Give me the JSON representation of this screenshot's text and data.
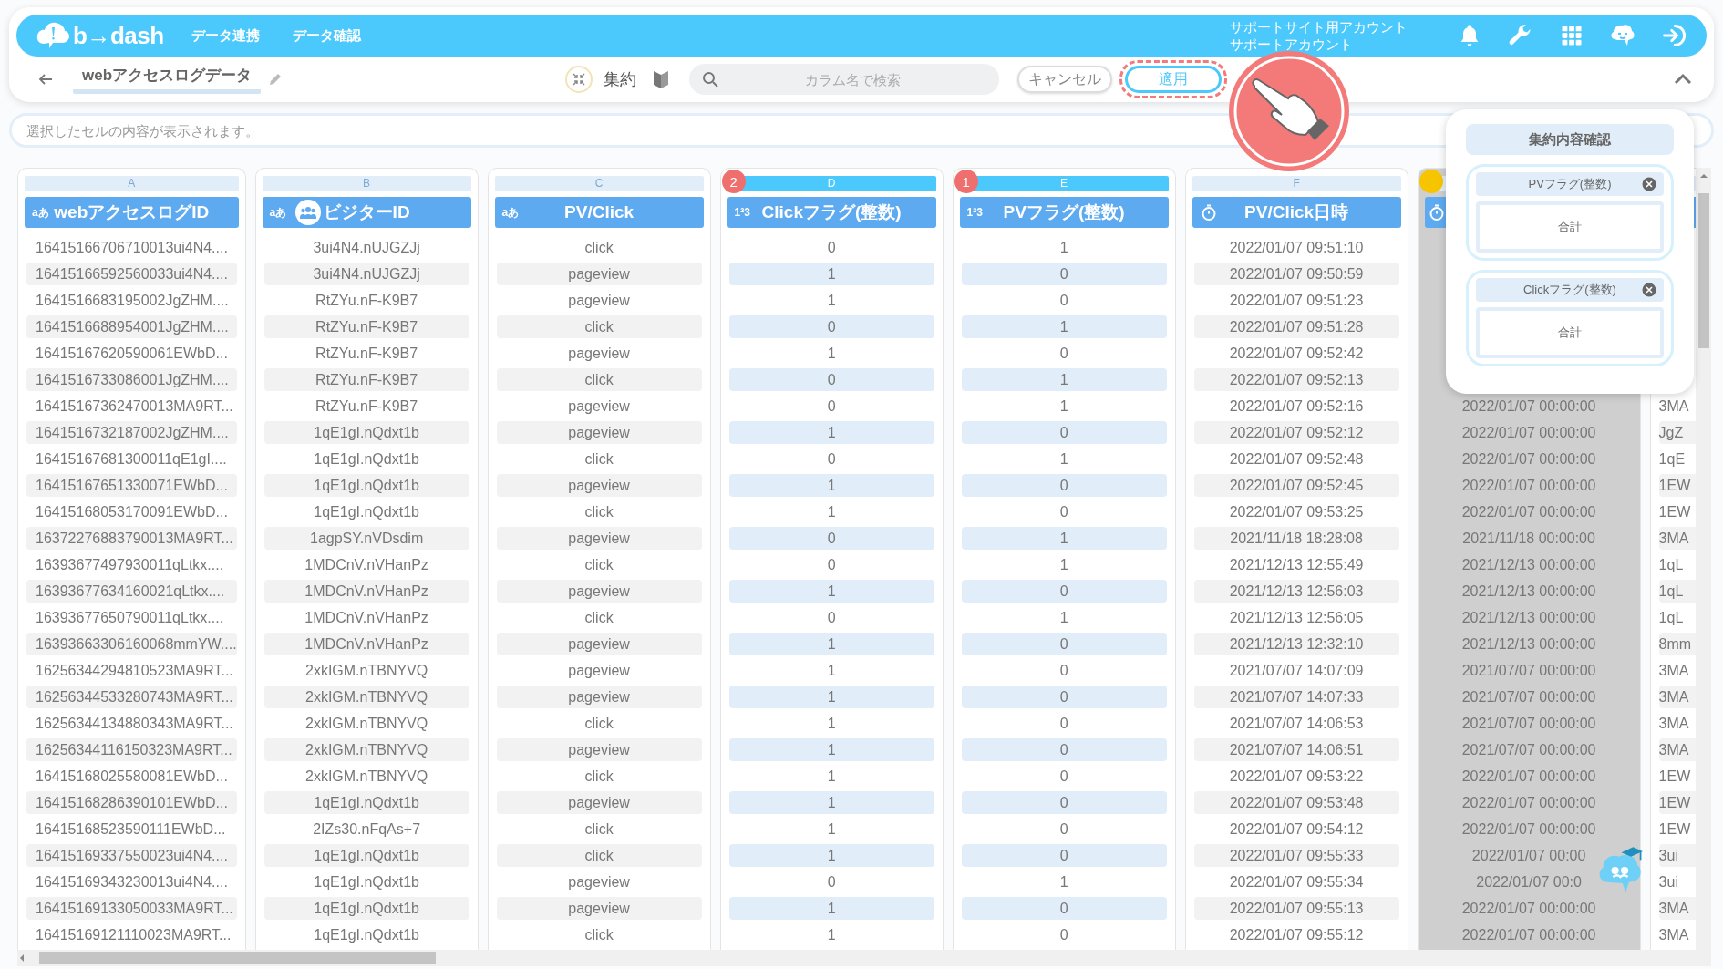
{
  "navbar": {
    "logo": "b→dash",
    "menu": [
      "データ連携",
      "データ確認"
    ],
    "account": [
      "サポートサイト用アカウント",
      "サポートアカウント"
    ]
  },
  "toolbar": {
    "title": "webアクセスログデータ",
    "aggregate_label": "集約",
    "search": {
      "placeholder": "カラム名で検索"
    },
    "cancel": "キャンセル",
    "apply": "適用",
    "apply_highlighted": true
  },
  "cell_viewer": {
    "placeholder": "選択したセルの内容が表示されます。"
  },
  "columns": [
    {
      "letter": "A",
      "title": "webアクセスログID",
      "kind": "text",
      "type_glyph": "aあ",
      "left_aligned": true,
      "user_key": false,
      "aggregated": false,
      "selected": false,
      "cells": [
        "16415166706710013ui4N4....",
        "16415166592560033ui4N4....",
        "1641516683195002JgZHM....",
        "1641516688954001JgZHM....",
        "16415167620590061EWbD...",
        "1641516733086001JgZHM....",
        "16415167362470013MA9RT...",
        "1641516732187002JgZHM....",
        "16415167681300011qE1gI....",
        "16415167651330071EWbD...",
        "16415168053170091EWbD...",
        "16372276883790013MA9RT...",
        "16393677497930011qLtkx....",
        "16393677634160021qLtkx....",
        "16393677650790011qLtkx....",
        "16393663306160068mmYW....",
        "16256344294810523MA9RT...",
        "16256344533280743MA9RT...",
        "16256344134880343MA9RT...",
        "16256344116150323MA9RT...",
        "16415168025580081EWbD...",
        "16415168286390101EWbD...",
        "16415168523590111EWbD...",
        "16415169337550023ui4N4....",
        "16415169343230013ui4N4....",
        "16415169133050033MA9RT...",
        "16415169121110023MA9RT..."
      ]
    },
    {
      "letter": "B",
      "title": "ビジターID",
      "kind": "text",
      "type_glyph": "aあ",
      "left_aligned": false,
      "user_key": true,
      "aggregated": false,
      "selected": false,
      "cells": [
        "3ui4N4.nUJGZJj",
        "3ui4N4.nUJGZJj",
        "RtZYu.nF-K9B7",
        "RtZYu.nF-K9B7",
        "RtZYu.nF-K9B7",
        "RtZYu.nF-K9B7",
        "RtZYu.nF-K9B7",
        "1qE1gI.nQdxt1b",
        "1qE1gI.nQdxt1b",
        "1qE1gI.nQdxt1b",
        "1qE1gI.nQdxt1b",
        "1agpSY.nVDsdim",
        "1MDCnV.nVHanPz",
        "1MDCnV.nVHanPz",
        "1MDCnV.nVHanPz",
        "1MDCnV.nVHanPz",
        "2xkIGM.nTBNYVQ",
        "2xkIGM.nTBNYVQ",
        "2xkIGM.nTBNYVQ",
        "2xkIGM.nTBNYVQ",
        "2xkIGM.nTBNYVQ",
        "1qE1gI.nQdxt1b",
        "2IZs30.nFqAs+7",
        "1qE1gI.nQdxt1b",
        "1qE1gI.nQdxt1b",
        "1qE1gI.nQdxt1b",
        "1qE1gI.nQdxt1b"
      ]
    },
    {
      "letter": "C",
      "title": "PV/Click",
      "kind": "text",
      "type_glyph": "aあ",
      "left_aligned": false,
      "user_key": false,
      "aggregated": false,
      "selected": false,
      "cells": [
        "click",
        "pageview",
        "pageview",
        "click",
        "pageview",
        "click",
        "pageview",
        "pageview",
        "click",
        "pageview",
        "click",
        "pageview",
        "click",
        "pageview",
        "click",
        "pageview",
        "pageview",
        "pageview",
        "click",
        "pageview",
        "click",
        "pageview",
        "click",
        "click",
        "pageview",
        "pageview",
        "click"
      ]
    },
    {
      "letter": "D",
      "title": "Clickフラグ(整数)",
      "kind": "number",
      "type_glyph": "1²3",
      "left_aligned": false,
      "user_key": false,
      "aggregated": true,
      "badge": "2",
      "selected": false,
      "cells": [
        "0",
        "1",
        "1",
        "0",
        "1",
        "0",
        "0",
        "1",
        "0",
        "1",
        "1",
        "0",
        "0",
        "1",
        "0",
        "1",
        "1",
        "1",
        "1",
        "1",
        "1",
        "1",
        "1",
        "1",
        "0",
        "1",
        "1"
      ]
    },
    {
      "letter": "E",
      "title": "PVフラグ(整数)",
      "kind": "number",
      "type_glyph": "1²3",
      "left_aligned": false,
      "user_key": false,
      "aggregated": true,
      "badge": "1",
      "selected": false,
      "cells": [
        "1",
        "0",
        "0",
        "1",
        "0",
        "1",
        "1",
        "0",
        "1",
        "0",
        "0",
        "1",
        "1",
        "0",
        "1",
        "0",
        "0",
        "0",
        "0",
        "0",
        "0",
        "0",
        "0",
        "0",
        "1",
        "0",
        "0"
      ]
    },
    {
      "letter": "F",
      "title": "PV/Click日時",
      "kind": "datetime",
      "left_aligned": false,
      "user_key": false,
      "aggregated": false,
      "selected": false,
      "cells": [
        "2022/01/07 09:51:10",
        "2022/01/07 09:50:59",
        "2022/01/07 09:51:23",
        "2022/01/07 09:51:28",
        "2022/01/07 09:52:42",
        "2022/01/07 09:52:13",
        "2022/01/07 09:52:16",
        "2022/01/07 09:52:12",
        "2022/01/07 09:52:48",
        "2022/01/07 09:52:45",
        "2022/01/07 09:53:25",
        "2021/11/18 18:28:08",
        "2021/12/13 12:55:49",
        "2021/12/13 12:56:03",
        "2021/12/13 12:56:05",
        "2021/12/13 12:32:10",
        "2021/07/07 14:07:09",
        "2021/07/07 14:07:33",
        "2021/07/07 14:06:53",
        "2021/07/07 14:06:51",
        "2022/01/07 09:53:22",
        "2022/01/07 09:53:48",
        "2022/01/07 09:54:12",
        "2022/01/07 09:55:33",
        "2022/01/07 09:55:34",
        "2022/01/07 09:55:13",
        "2022/01/07 09:55:12"
      ]
    },
    {
      "kind": "datetime",
      "left_aligned": false,
      "selected": true,
      "marked": true,
      "cells": [
        null,
        null,
        null,
        null,
        null,
        null,
        "2022/01/07 00:00:00",
        "2022/01/07 00:00:00",
        "2022/01/07 00:00:00",
        "2022/01/07 00:00:00",
        "2022/01/07 00:00:00",
        "2021/11/18 00:00:00",
        "2021/12/13 00:00:00",
        "2021/12/13 00:00:00",
        "2021/12/13 00:00:00",
        "2021/12/13 00:00:00",
        "2021/07/07 00:00:00",
        "2021/07/07 00:00:00",
        "2021/07/07 00:00:00",
        "2021/07/07 00:00:00",
        "2022/01/07 00:00:00",
        "2022/01/07 00:00:00",
        "2022/01/07 00:00:00",
        "2022/01/07 00:00",
        "2022/01/07 00:0",
        "2022/01/07 00:00:00",
        "2022/01/07 00:00:00"
      ]
    },
    {
      "left_aligned": true,
      "selected": false,
      "cells": [
        null,
        null,
        null,
        null,
        null,
        null,
        "3MA",
        "JgZ",
        "1qE",
        "1EW",
        "1EW",
        "3MA",
        "1qL",
        "1qL",
        "1qL",
        "8mm",
        "3MA",
        "3MA",
        "3MA",
        "3MA",
        "1EW",
        "1EW",
        "1EW",
        "3ui",
        "3ui",
        "3MA",
        "3MA"
      ]
    }
  ],
  "aggregation_panel": {
    "title": "集約内容確認",
    "items": [
      {
        "column": "PVフラグ(整数)",
        "function": "合計"
      },
      {
        "column": "Clickフラグ(整数)",
        "function": "合計"
      }
    ]
  }
}
